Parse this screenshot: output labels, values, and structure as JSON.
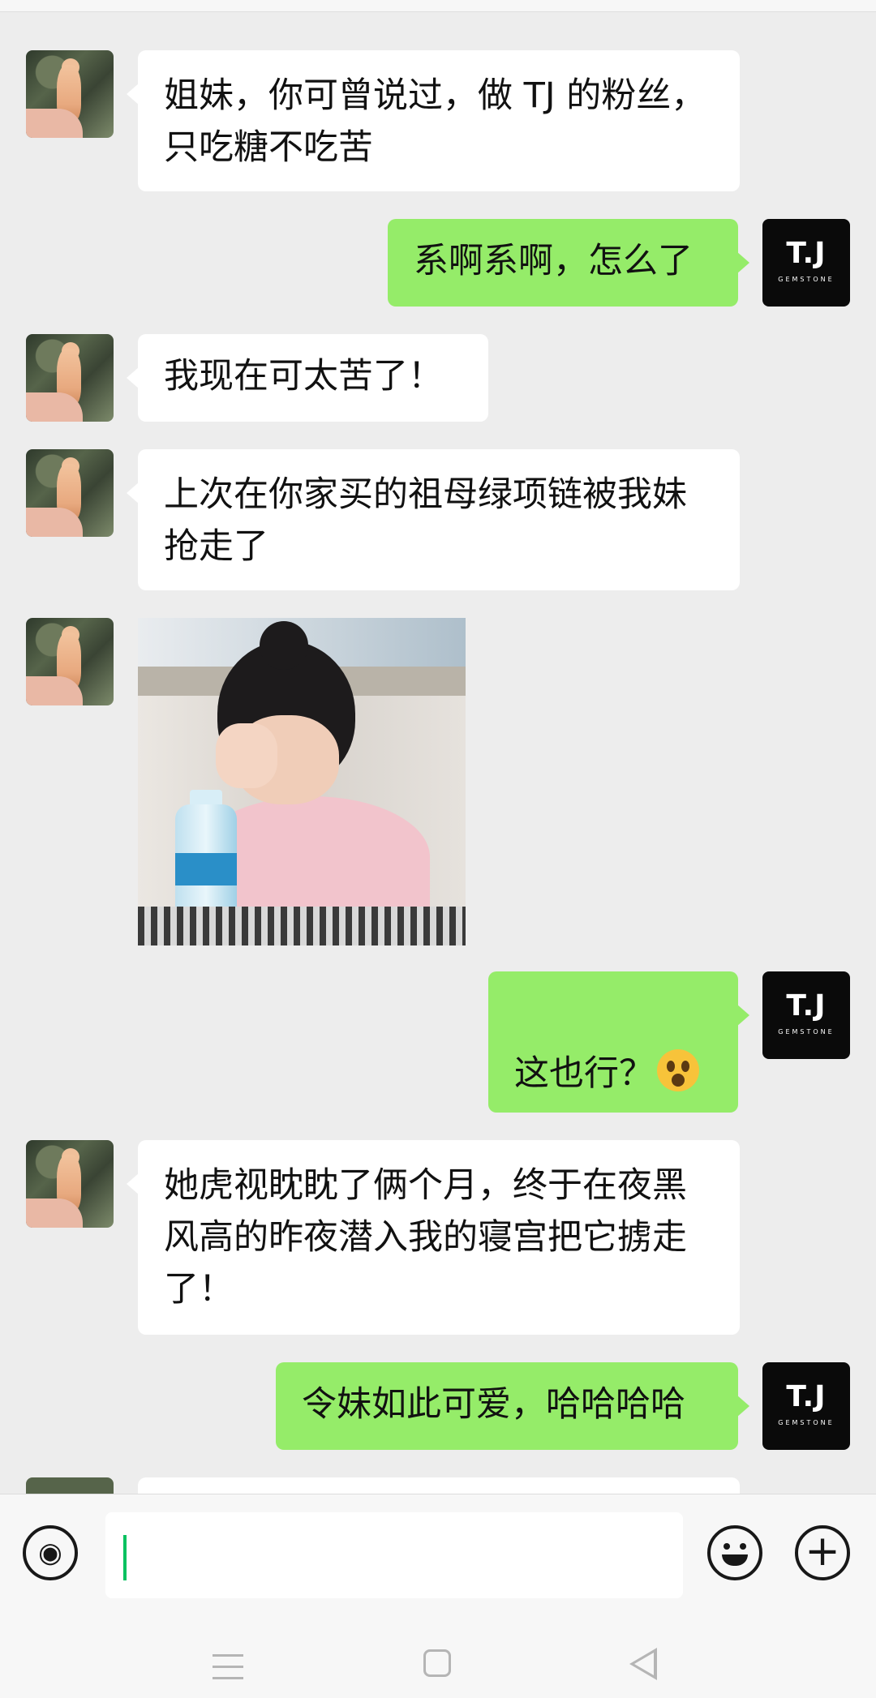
{
  "chat": {
    "messages": [
      {
        "sender": "friend",
        "text": "姐妹，你可曾说过，做 TJ 的粉丝，只吃糖不吃苦"
      },
      {
        "sender": "me",
        "text": "系啊系啊，怎么了"
      },
      {
        "sender": "friend",
        "text": "我现在可太苦了！"
      },
      {
        "sender": "friend",
        "text": "上次在你家买的祖母绿项链被我妹抢走了"
      },
      {
        "sender": "friend",
        "type": "image",
        "image_desc": "girl-covering-face-meme"
      },
      {
        "sender": "me",
        "text": "这也行？",
        "emoji": "shocked-emoji"
      },
      {
        "sender": "friend",
        "text": "她虎视眈眈了俩个月，终于在夜黑风高的昨夜潜入我的寝宫把它掳走了！"
      },
      {
        "sender": "me",
        "text": "令妹如此可爱，哈哈哈哈"
      }
    ]
  },
  "avatars": {
    "me": {
      "logo_main": "T.J",
      "logo_sub": "GEMSTONE"
    },
    "friend": {
      "icon": "duck-figurine-avatar"
    }
  },
  "input_bar": {
    "voice_icon": "voice-icon",
    "emoji_icon": "emoji-icon",
    "plus_icon": "plus-icon",
    "value": ""
  },
  "nav_bar": {
    "icons": [
      "menu-icon",
      "home-icon",
      "back-icon"
    ]
  },
  "colors": {
    "background": "#ededed",
    "friend_bubble": "#ffffff",
    "my_bubble": "#95ec69",
    "caret": "#07c160"
  }
}
